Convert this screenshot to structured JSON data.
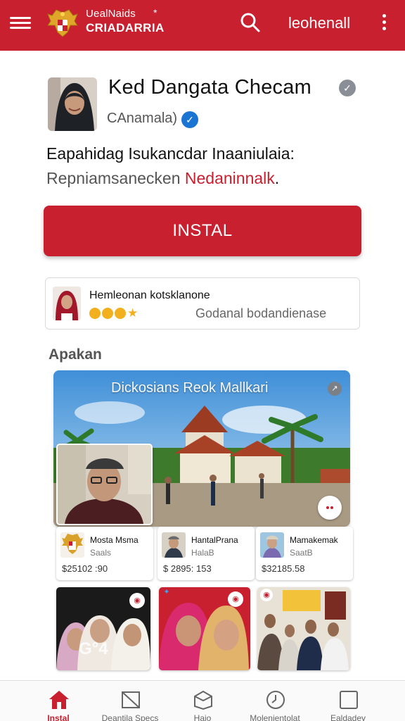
{
  "brand": {
    "line1": "UealNaids",
    "line2": "CRIADARRIA",
    "star": "*"
  },
  "topbar": {
    "user_label": "leohenall"
  },
  "app": {
    "title": "Ked Dangata Checam",
    "developer": "CAnamala)",
    "tagline": "Eapahidag Isukancdar Inaaniulaia:",
    "subline_plain": "Repniamsanecken ",
    "subline_highlight": "Nedaninnalk",
    "subline_end": ".",
    "install_label": "INSTAL"
  },
  "review": {
    "title": "Hemleonan kotsklanone",
    "caption": "Godanal bodandienase",
    "rating": 4
  },
  "section": {
    "title": "Apakan"
  },
  "feature": {
    "title": "Dickosians Reok Mallkari"
  },
  "products": [
    {
      "name": "Mosta Msma",
      "sub": "Saals",
      "price": "$25102 :90"
    },
    {
      "name": "HantalPrana",
      "sub": "HalaB",
      "price": "$ 2895: 153"
    },
    {
      "name": "Mamakemak",
      "sub": "SaatB",
      "price": "$32185.58"
    }
  ],
  "tiles": [
    {
      "overlay": "G°4"
    },
    {
      "overlay": ""
    },
    {
      "overlay": ""
    }
  ],
  "nav": [
    {
      "label": "Instal",
      "icon": "home-icon",
      "active": true
    },
    {
      "label": "Deantila Specs",
      "icon": "image-off-icon",
      "active": false
    },
    {
      "label": "Hajo",
      "icon": "box-icon",
      "active": false
    },
    {
      "label": "Molenientolat",
      "icon": "clock-icon",
      "active": false
    },
    {
      "label": "Ealdadey",
      "icon": "square-icon",
      "active": false
    }
  ],
  "colors": {
    "primary": "#c8202f",
    "verified": "#1a75d2",
    "star": "#f2b01e"
  }
}
